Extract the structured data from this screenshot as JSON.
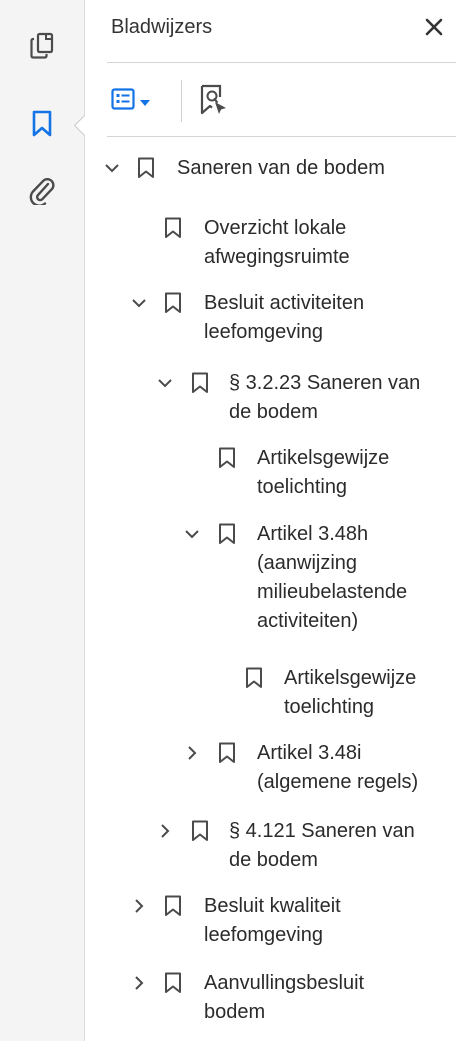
{
  "panel": {
    "title": "Bladwijzers",
    "close_icon": "close-icon",
    "options_icon": "list-options-icon",
    "find_icon": "find-bookmark-icon"
  },
  "rail": {
    "items": [
      {
        "name": "pages",
        "icon": "pages-icon"
      },
      {
        "name": "bookmarks",
        "icon": "bookmark-icon",
        "active": true
      },
      {
        "name": "attachments",
        "icon": "paperclip-icon"
      }
    ]
  },
  "colors": {
    "accent": "#1473e6",
    "icon": "#4b4b4b",
    "text": "#2b2b2b"
  },
  "tree": [
    {
      "state": "expanded",
      "label": [
        "Saneren van de bodem"
      ]
    },
    {
      "state": "leaf",
      "label": [
        "Overzicht lokale",
        "afwegingsruimte"
      ]
    },
    {
      "state": "expanded",
      "label": [
        "Besluit activiteiten",
        "leefomgeving"
      ]
    },
    {
      "state": "expanded",
      "label": [
        "§ 3.2.23 Saneren van",
        "de bodem"
      ]
    },
    {
      "state": "leaf",
      "label": [
        "Artikelsgewijze",
        "toelichting"
      ]
    },
    {
      "state": "expanded",
      "label": [
        "Artikel 3.48h",
        "(aanwijzing",
        "milieubelastende",
        "activiteiten)"
      ]
    },
    {
      "state": "leaf",
      "label": [
        "Artikelsgewijze",
        "toelichting"
      ]
    },
    {
      "state": "collapsed",
      "label": [
        "Artikel 3.48i",
        "(algemene regels)"
      ]
    },
    {
      "state": "collapsed",
      "label": [
        "§ 4.121 Saneren van",
        "de bodem"
      ]
    },
    {
      "state": "collapsed",
      "label": [
        "Besluit kwaliteit",
        "leefomgeving"
      ]
    },
    {
      "state": "collapsed",
      "label": [
        "Aanvullingsbesluit",
        "bodem"
      ]
    }
  ]
}
